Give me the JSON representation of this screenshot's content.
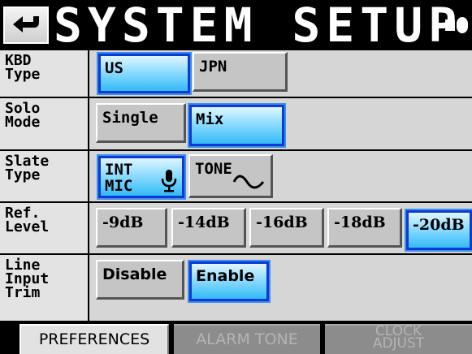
{
  "header": {
    "title": "SYSTEM SETUP"
  },
  "rows": {
    "kbd_type": {
      "label": "KBD\nType",
      "options": [
        "US",
        "JPN"
      ],
      "selected": "US"
    },
    "solo_mode": {
      "label": "Solo\nMode",
      "options": [
        "Single",
        "Mix"
      ],
      "selected": "Mix"
    },
    "slate_type": {
      "label": "Slate\nType",
      "options": [
        "INT\nMIC",
        "TONE"
      ],
      "selected": "INT\nMIC"
    },
    "ref_level": {
      "label": "Ref.\nLevel",
      "options": [
        "-9dB",
        "-14dB",
        "-16dB",
        "-18dB",
        "-20dB"
      ],
      "selected": "-20dB"
    },
    "line_input_trim": {
      "label": "Line\nInput\nTrim",
      "options": [
        "Disable",
        "Enable"
      ],
      "selected": "Enable"
    }
  },
  "tabs": {
    "preferences": "PREFERENCES",
    "alarm_tone": "ALARM TONE",
    "clock_adjust": "CLOCK\nADJUST",
    "active": "PREFERENCES"
  },
  "colors": {
    "selected_fill": "#33bbf5",
    "selected_border": "#0b3ad6",
    "panel_bg": "#d6d6d6"
  },
  "icons": {
    "back": "return-arrow-icon",
    "power": "power-plug-icon",
    "mic": "microphone-icon",
    "tone": "sine-wave-icon"
  }
}
